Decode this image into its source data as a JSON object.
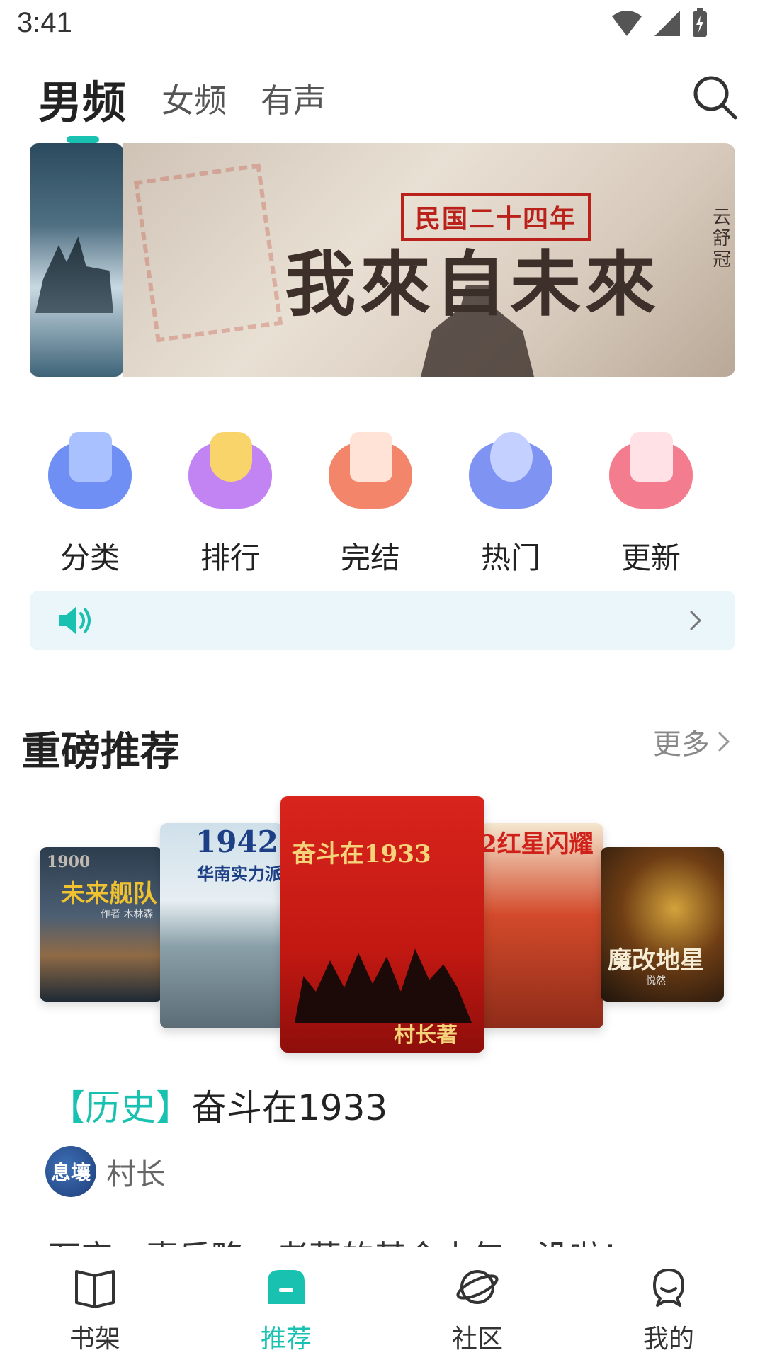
{
  "status_bar": {
    "time": "3:41"
  },
  "top_tabs": [
    {
      "label": "男频",
      "active": true
    },
    {
      "label": "女频",
      "active": false
    },
    {
      "label": "有声",
      "active": false
    }
  ],
  "banner": {
    "subtitle": "民国二十四年",
    "title": "我來自未來",
    "side_text": "云舒冠"
  },
  "categories": [
    {
      "label": "分类",
      "icon": "category-icon",
      "color": "#6f8ff5"
    },
    {
      "label": "排行",
      "icon": "trophy-icon",
      "color": "#c184f2"
    },
    {
      "label": "完结",
      "icon": "completed-icon",
      "color": "#f3866a"
    },
    {
      "label": "热门",
      "icon": "fire-icon",
      "color": "#7f94f2"
    },
    {
      "label": "更新",
      "icon": "update-icon",
      "color": "#f37d8f"
    }
  ],
  "section": {
    "title": "重磅推荐",
    "more_label": "更多"
  },
  "books": [
    {
      "cover_title": "未来舰队",
      "cover_top": "1900",
      "cover_author": "作者 木林森"
    },
    {
      "cover_title": "华南实力派",
      "cover_top": "1942"
    },
    {
      "cover_title": "奋斗在1933",
      "cover_author": "村长著"
    },
    {
      "cover_title": "2红星闪耀"
    },
    {
      "cover_title": "魔改地星",
      "cover_author": "悦然"
    }
  ],
  "featured": {
    "genre": "【历史】",
    "title": "奋斗在1933",
    "author_avatar_text": "息壤",
    "author": "村长",
    "description": "万字，喜乐略，老落的基金十年，没啦！"
  },
  "bottom_nav": [
    {
      "label": "书架",
      "icon": "bookshelf-icon",
      "active": false
    },
    {
      "label": "推荐",
      "icon": "recommend-icon",
      "active": true
    },
    {
      "label": "社区",
      "icon": "community-icon",
      "active": false
    },
    {
      "label": "我的",
      "icon": "profile-icon",
      "active": false
    }
  ],
  "colors": {
    "accent": "#19c2b0",
    "notice_bg": "#eaf6f9"
  }
}
